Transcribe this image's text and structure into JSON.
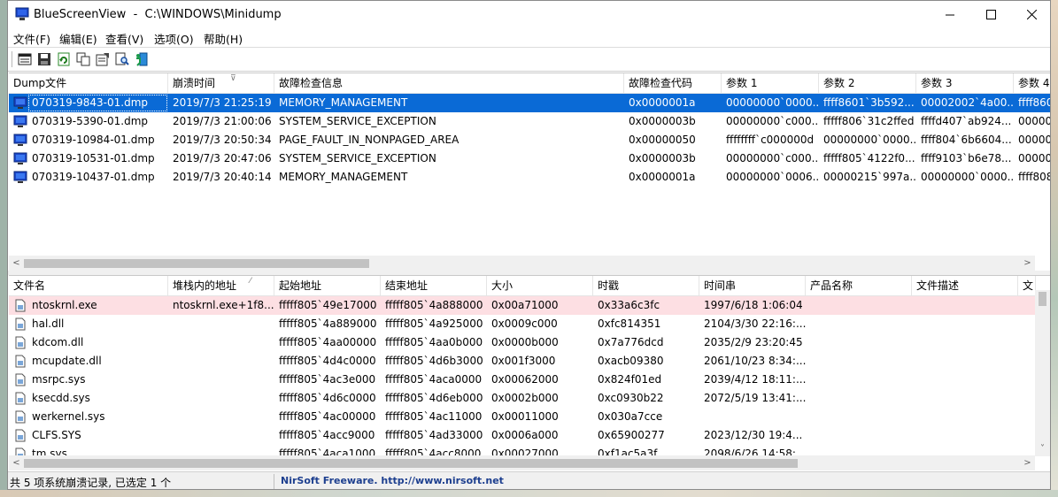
{
  "window": {
    "title": "BlueScreenView  -  C:\\WINDOWS\\Minidump",
    "controls": {
      "minimize": "—",
      "maximize": "☐",
      "close": "✕"
    }
  },
  "menu": [
    "文件(F)",
    "编辑(E)",
    "查看(V)",
    "选项(O)",
    "帮助(H)"
  ],
  "toolbar": [
    "html-report-icon",
    "save-icon",
    "refresh-icon",
    "copy-icon",
    "properties-icon",
    "find-icon",
    "exit-icon"
  ],
  "crash_table": {
    "columns": [
      "Dump文件",
      "崩溃时间",
      "故障检查信息",
      "故障检查代码",
      "参数 1",
      "参数 2",
      "参数 3",
      "参数 4"
    ],
    "rows": [
      [
        "070319-9843-01.dmp",
        "2019/7/3 21:25:19",
        "MEMORY_MANAGEMENT",
        "0x0000001a",
        "00000000`0000...",
        "ffff8601`3b592...",
        "00002002`4a00...",
        "ffff860..."
      ],
      [
        "070319-5390-01.dmp",
        "2019/7/3 21:00:06",
        "SYSTEM_SERVICE_EXCEPTION",
        "0x0000003b",
        "00000000`c000...",
        "fffff806`31c2ffed",
        "ffffd407`ab924...",
        "000000..."
      ],
      [
        "070319-10984-01.dmp",
        "2019/7/3 20:50:34",
        "PAGE_FAULT_IN_NONPAGED_AREA",
        "0x00000050",
        "ffffffff`c000000d",
        "00000000`0000...",
        "ffff804`6b6604...",
        "000000..."
      ],
      [
        "070319-10531-01.dmp",
        "2019/7/3 20:47:06",
        "SYSTEM_SERVICE_EXCEPTION",
        "0x0000003b",
        "00000000`c000...",
        "fffff805`4122f0...",
        "ffff9103`b6e78...",
        "000000..."
      ],
      [
        "070319-10437-01.dmp",
        "2019/7/3 20:40:14",
        "MEMORY_MANAGEMENT",
        "0x0000001a",
        "00000000`0006...",
        "00000215`997a...",
        "00000000`0000...",
        "ffff808..."
      ]
    ]
  },
  "driver_table": {
    "columns": [
      "文件名",
      "堆栈内的地址",
      "起始地址",
      "结束地址",
      "大小",
      "时戳",
      "时间串",
      "产品名称",
      "文件描述",
      "文"
    ],
    "rows": [
      [
        "ntoskrnl.exe",
        "ntoskrnl.exe+1f8...",
        "fffff805`49e17000",
        "fffff805`4a888000",
        "0x00a71000",
        "0x33a6c3fc",
        "1997/6/18 1:06:04",
        "",
        "",
        ""
      ],
      [
        "hal.dll",
        "",
        "fffff805`4a889000",
        "fffff805`4a925000",
        "0x0009c000",
        "0xfc814351",
        "2104/3/30 22:16:...",
        "",
        "",
        ""
      ],
      [
        "kdcom.dll",
        "",
        "fffff805`4aa00000",
        "fffff805`4aa0b000",
        "0x0000b000",
        "0x7a776dcd",
        "2035/2/9 23:20:45",
        "",
        "",
        ""
      ],
      [
        "mcupdate.dll",
        "",
        "fffff805`4d4c0000",
        "fffff805`4d6b3000",
        "0x001f3000",
        "0xacb09380",
        "2061/10/23 8:34:...",
        "",
        "",
        ""
      ],
      [
        "msrpc.sys",
        "",
        "fffff805`4ac3e000",
        "fffff805`4aca0000",
        "0x00062000",
        "0x824f01ed",
        "2039/4/12 18:11:...",
        "",
        "",
        ""
      ],
      [
        "ksecdd.sys",
        "",
        "fffff805`4d6c0000",
        "fffff805`4d6eb000",
        "0x0002b000",
        "0xc0930b22",
        "2072/5/19 13:41:...",
        "",
        "",
        ""
      ],
      [
        "werkernel.sys",
        "",
        "fffff805`4ac00000",
        "fffff805`4ac11000",
        "0x00011000",
        "0x030a7cce",
        "",
        "",
        "",
        ""
      ],
      [
        "CLFS.SYS",
        "",
        "fffff805`4acc9000",
        "fffff805`4ad33000",
        "0x0006a000",
        "0x65900277",
        "2023/12/30 19:4...",
        "",
        "",
        ""
      ],
      [
        "tm.sys",
        "",
        "fffff805`4aca1000",
        "fffff805`4acc8000",
        "0x00027000",
        "0xf1ac5a3f",
        "2098/6/26 14:58:...",
        "",
        "",
        ""
      ]
    ]
  },
  "status": {
    "summary": "共 5 项系统崩溃记录, 已选定 1 个",
    "credit": "NirSoft Freeware.  http://www.nirsoft.net"
  },
  "colors": {
    "selection": "#0a6ad6",
    "highlight_row": "#fddfe3",
    "credit_text": "#1d3f8f"
  }
}
